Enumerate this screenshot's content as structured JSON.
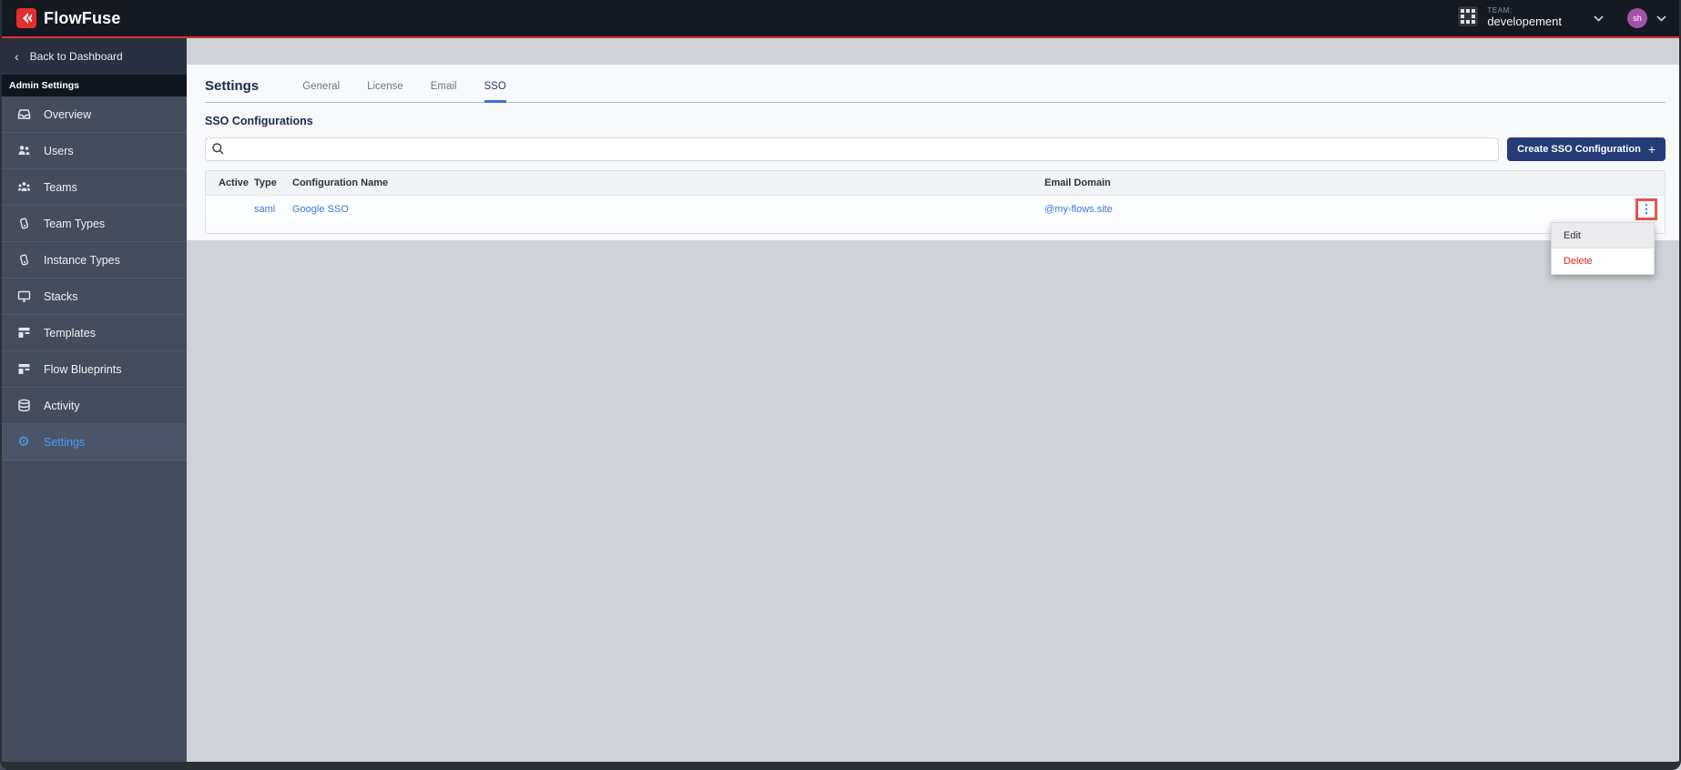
{
  "brand": {
    "name": "FlowFuse",
    "accent_red": "#e0312d",
    "button_navy": "#253c78",
    "link_blue": "#3b76d9",
    "active_blue": "#4b9bf5",
    "delete_red": "#d92626",
    "avatar_purple": "#a552ab"
  },
  "topbar": {
    "team_label": "TEAM:",
    "team_name": "developement",
    "avatar_initials": "sh"
  },
  "sidebar": {
    "back_label": "Back to Dashboard",
    "back_chevron": "‹",
    "section_label": "Admin Settings",
    "items": [
      {
        "label": "Overview",
        "icon": "tray-icon"
      },
      {
        "label": "Users",
        "icon": "users-icon"
      },
      {
        "label": "Teams",
        "icon": "user-group-icon"
      },
      {
        "label": "Team Types",
        "icon": "ticket-icon"
      },
      {
        "label": "Instance Types",
        "icon": "ticket-icon"
      },
      {
        "label": "Stacks",
        "icon": "desktop-icon"
      },
      {
        "label": "Templates",
        "icon": "template-icon"
      },
      {
        "label": "Flow Blueprints",
        "icon": "template-icon"
      },
      {
        "label": "Activity",
        "icon": "database-icon"
      },
      {
        "label": "Settings",
        "icon": "gear-icon",
        "active": true
      }
    ],
    "gear_glyph": "⚙"
  },
  "page": {
    "title": "Settings",
    "tabs": [
      {
        "label": "General",
        "active": false
      },
      {
        "label": "License",
        "active": false
      },
      {
        "label": "Email",
        "active": false
      },
      {
        "label": "SSO",
        "active": true
      }
    ],
    "section_title": "SSO Configurations",
    "toolbar": {
      "search_placeholder": "",
      "search_value": "",
      "create_label": "Create SSO Configuration",
      "plus_glyph": "+"
    },
    "table": {
      "columns": [
        "Active",
        "Type",
        "Configuration Name",
        "Email Domain"
      ],
      "rows": [
        {
          "active": "",
          "type": "saml",
          "name": "Google SSO",
          "email_domain": "@my-flows.site"
        }
      ],
      "kebab_glyph": "⋮"
    },
    "context_menu": {
      "items": [
        {
          "label": "Edit",
          "danger": false
        },
        {
          "label": "Delete",
          "danger": true
        }
      ]
    }
  }
}
